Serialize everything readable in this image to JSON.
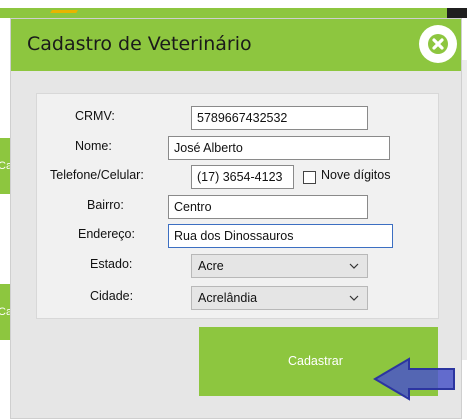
{
  "dialog": {
    "title": "Cadastro de Veterinário",
    "close_icon": "close-x-icon"
  },
  "background": {
    "side_button_1": "Cad",
    "side_button_2": "Ca"
  },
  "form": {
    "crmv": {
      "label": "CRMV:",
      "value": "5789667432532"
    },
    "nome": {
      "label": "Nome:",
      "value": "José Alberto"
    },
    "telefone": {
      "label": "Telefone/Celular:",
      "value": "(17) 3654-4123",
      "nove_digitos_label": "Nove dígitos",
      "nove_digitos_checked": false
    },
    "bairro": {
      "label": "Bairro:",
      "value": "Centro"
    },
    "endereco": {
      "label": "Endereço:",
      "value": "Rua dos Dinossauros"
    },
    "estado": {
      "label": "Estado:",
      "selected": "Acre"
    },
    "cidade": {
      "label": "Cidade:",
      "selected": "Acrelândia"
    }
  },
  "submit": {
    "label": "Cadastrar"
  },
  "annotation": {
    "icon": "left-arrow-pointer-icon",
    "color": "#4a55c8"
  },
  "colors": {
    "accent": "#8dc63f",
    "focus": "#3c6fc2"
  }
}
